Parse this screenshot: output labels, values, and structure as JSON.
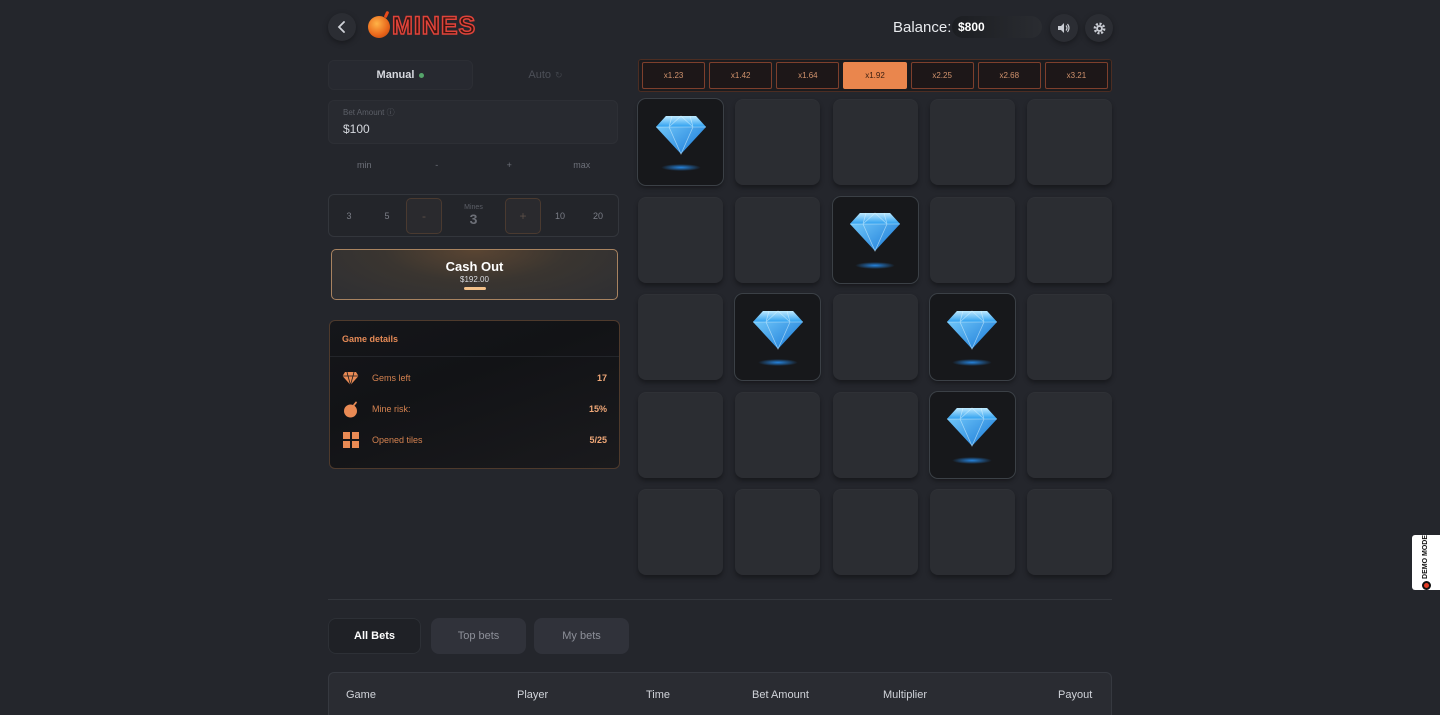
{
  "header": {
    "logo_text": "MINES",
    "balance_label": "Balance:",
    "balance_value": "$800"
  },
  "mode_tabs": [
    {
      "label": "Manual",
      "active": true
    },
    {
      "label": "Auto",
      "active": false
    }
  ],
  "bet": {
    "label": "Bet Amount",
    "value": "$100",
    "controls": [
      "min",
      "-",
      "+",
      "max"
    ]
  },
  "mines_selector": {
    "quick_left": [
      "3",
      "5"
    ],
    "decrement": "-",
    "label": "Mines",
    "value": "3",
    "increment": "+",
    "quick_right": [
      "10",
      "20"
    ]
  },
  "cashout": {
    "title": "Cash Out",
    "amount": "$192.00"
  },
  "game_details": {
    "title": "Game details",
    "rows": [
      {
        "label": "Gems left",
        "value": "17",
        "icon": "gem-icon"
      },
      {
        "label": "Mine risk:",
        "value": "15%",
        "icon": "bomb-icon"
      },
      {
        "label": "Opened tiles",
        "value": "5/25",
        "icon": "tiles-icon"
      }
    ]
  },
  "multipliers": [
    "x1.23",
    "x1.42",
    "x1.64",
    "x1.92",
    "x2.25",
    "x2.68",
    "x3.21"
  ],
  "active_multiplier_index": 3,
  "board": {
    "gems": [
      [
        0,
        0
      ],
      [
        1,
        2
      ],
      [
        2,
        1
      ],
      [
        2,
        3
      ],
      [
        3,
        3
      ]
    ]
  },
  "bets_tabs": [
    "All Bets",
    "Top bets",
    "My bets"
  ],
  "table_headers": [
    "Game",
    "Player",
    "Time",
    "Bet Amount",
    "Multiplier",
    "Payout"
  ],
  "demo_badge": "DEMO MODE",
  "colors": {
    "accent": "#ea864d",
    "background": "#24262c",
    "tile": "#2b2d32",
    "gem": "#4fc3ff"
  }
}
